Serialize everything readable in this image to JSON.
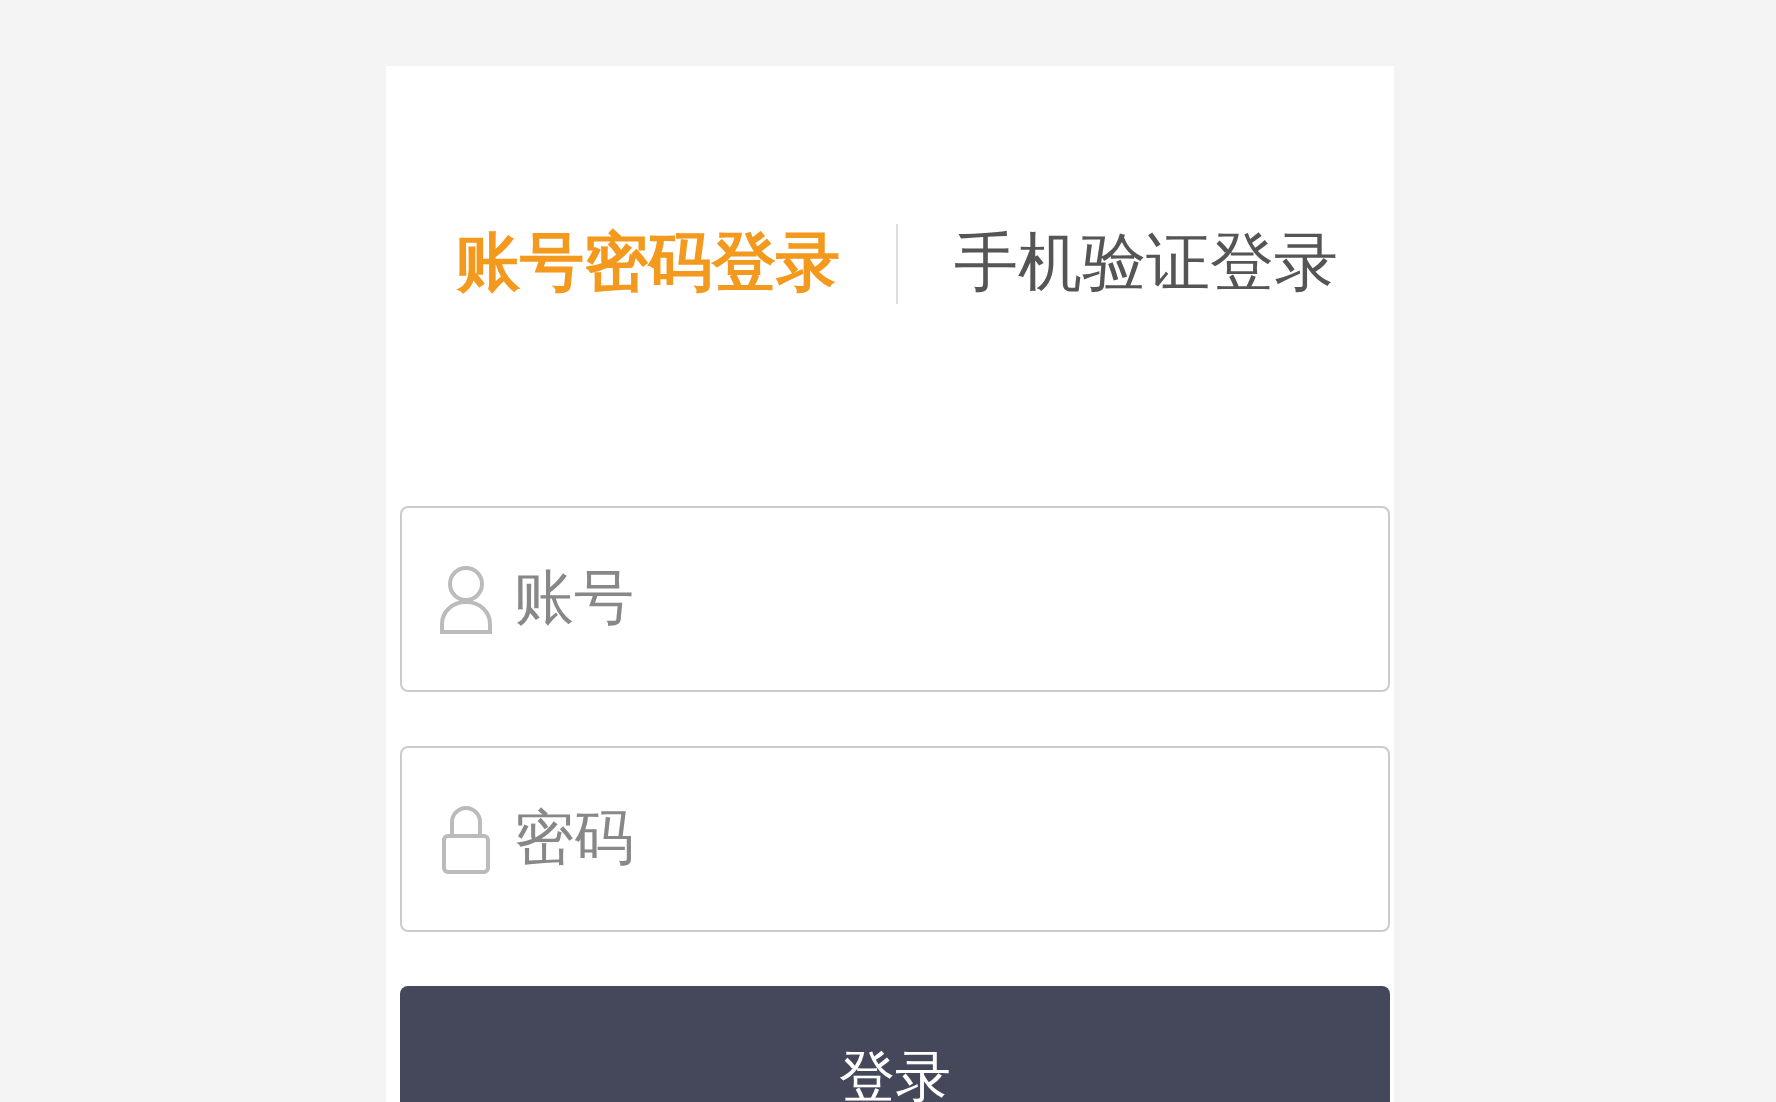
{
  "tabs": [
    {
      "label": "账号密码登录",
      "selected": true
    },
    {
      "label": "手机验证登录",
      "selected": false
    }
  ],
  "fields": [
    {
      "kind": "user",
      "placeholder": "账号"
    },
    {
      "kind": "lock",
      "placeholder": "密码"
    }
  ],
  "submit": {
    "label": "登录"
  }
}
